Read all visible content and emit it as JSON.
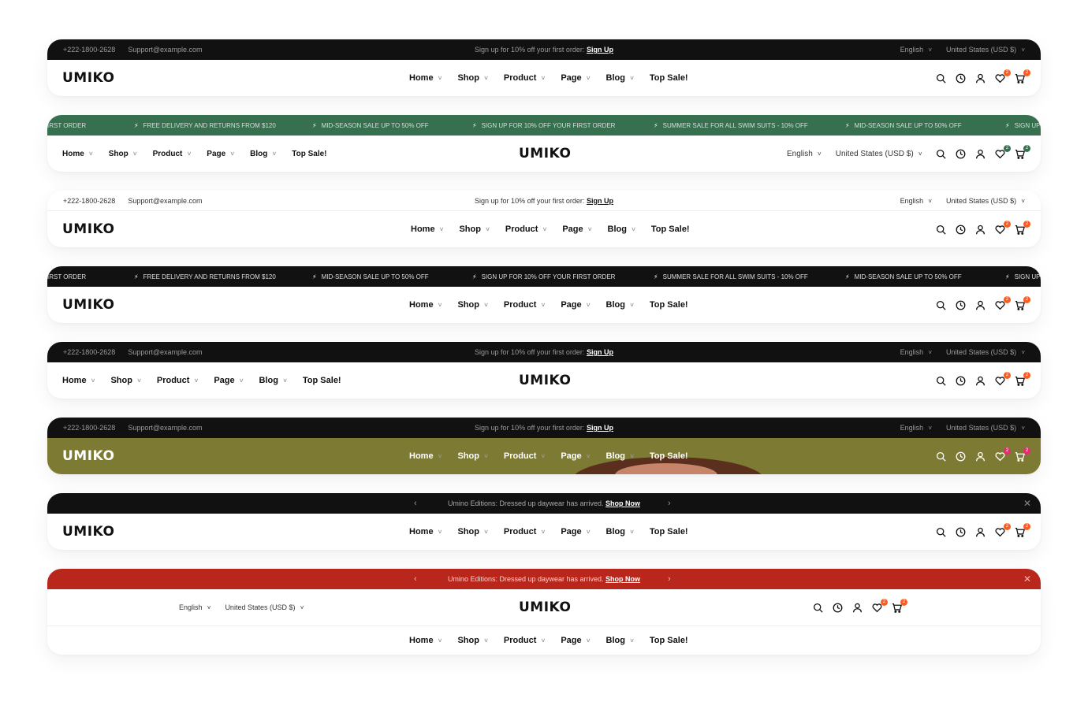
{
  "brand": {
    "logo": "UMIKO",
    "accent": "#ff5a1f"
  },
  "contact": {
    "phone": "+222-1800-2628",
    "email": "Support@example.com"
  },
  "promo": {
    "text": "Sign up for 10% off your first order:",
    "link": "Sign Up"
  },
  "locale": {
    "language": "English",
    "currency": "United States (USD $)",
    "currency_alt": "United States (USD $)"
  },
  "marquee": [
    "IRST ORDER",
    "FREE DELIVERY AND RETURNS FROM $120",
    "MID-SEASON SALE UP TO 50% OFF",
    "SIGN UP FOR 10% OFF YOUR FIRST ORDER",
    "SUMMER SALE FOR ALL SWIM SUITS - 10% OFF",
    "MID-SEASON SALE UP TO 50% OFF",
    "SIGN UP"
  ],
  "nav": [
    "Home",
    "Shop",
    "Product",
    "Page",
    "Blog",
    "Top Sale!"
  ],
  "announcement": {
    "text": "Umino Editions: Dressed up daywear has arrived.",
    "link": "Shop Now"
  },
  "badges": {
    "wishlist": "2",
    "cart": "2"
  },
  "icons": [
    "search-icon",
    "history-icon",
    "user-icon",
    "heart-icon",
    "cart-icon",
    "bolt-icon",
    "close-icon",
    "chevron-left-icon",
    "chevron-right-icon"
  ]
}
